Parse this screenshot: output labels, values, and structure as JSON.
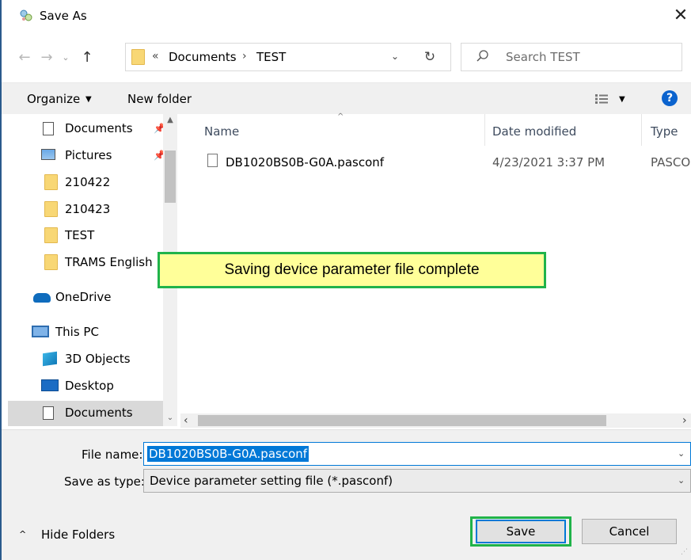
{
  "window": {
    "title": "Save As",
    "close_glyph": "✕"
  },
  "nav_buttons": {
    "back": "←",
    "forward": "→",
    "recent": "⌄",
    "up": "↑"
  },
  "address": {
    "chevron": "«",
    "crumbs": [
      "Documents",
      "TEST"
    ],
    "separator": "›",
    "dropdown": "⌄",
    "refresh": "↻"
  },
  "search": {
    "placeholder": "Search TEST"
  },
  "toolbar": {
    "organize": "Organize",
    "organize_caret": "▼",
    "new_folder": "New folder",
    "view_caret": "▼",
    "help": "?"
  },
  "nav_pane": {
    "items": [
      {
        "label": "Documents",
        "icon": "document-icon",
        "pinned": true
      },
      {
        "label": "Pictures",
        "icon": "pictures-icon",
        "pinned": true
      },
      {
        "label": "210422",
        "icon": "folder-icon"
      },
      {
        "label": "210423",
        "icon": "folder-icon"
      },
      {
        "label": "TEST",
        "icon": "folder-icon"
      },
      {
        "label": "TRAMS English",
        "icon": "folder-icon"
      },
      {
        "label": "OneDrive",
        "icon": "onedrive-icon"
      },
      {
        "label": "This PC",
        "icon": "pc-icon"
      },
      {
        "label": "3D Objects",
        "icon": "3d-objects-icon"
      },
      {
        "label": "Desktop",
        "icon": "desktop-icon"
      },
      {
        "label": "Documents",
        "icon": "document-icon",
        "selected": true
      }
    ],
    "pin_glyph": "📌",
    "scroll_up": "▲",
    "scroll_down": "⌄"
  },
  "file_list": {
    "sort_caret": "^",
    "columns": {
      "name": "Name",
      "date": "Date modified",
      "type": "Type"
    },
    "rows": [
      {
        "name": "DB1020BS0B-G0A.pasconf",
        "date": "4/23/2021 3:37 PM",
        "type": "PASCO"
      }
    ],
    "scroll_left": "‹",
    "scroll_right": "›"
  },
  "callout": {
    "text": "Saving device parameter file complete"
  },
  "form": {
    "filename_label": "File name:",
    "filename_value": "DB1020BS0B-G0A.pasconf",
    "savetype_label": "Save as type:",
    "savetype_value": "Device parameter setting file (*.pasconf)",
    "caret": "⌄"
  },
  "footer": {
    "hide_folders": "Hide Folders",
    "hide_caret": "^",
    "save": "Save",
    "cancel": "Cancel"
  },
  "colors": {
    "accent": "#0078d7",
    "highlight_outline": "#20b34a",
    "callout_bg": "#ffff99"
  }
}
